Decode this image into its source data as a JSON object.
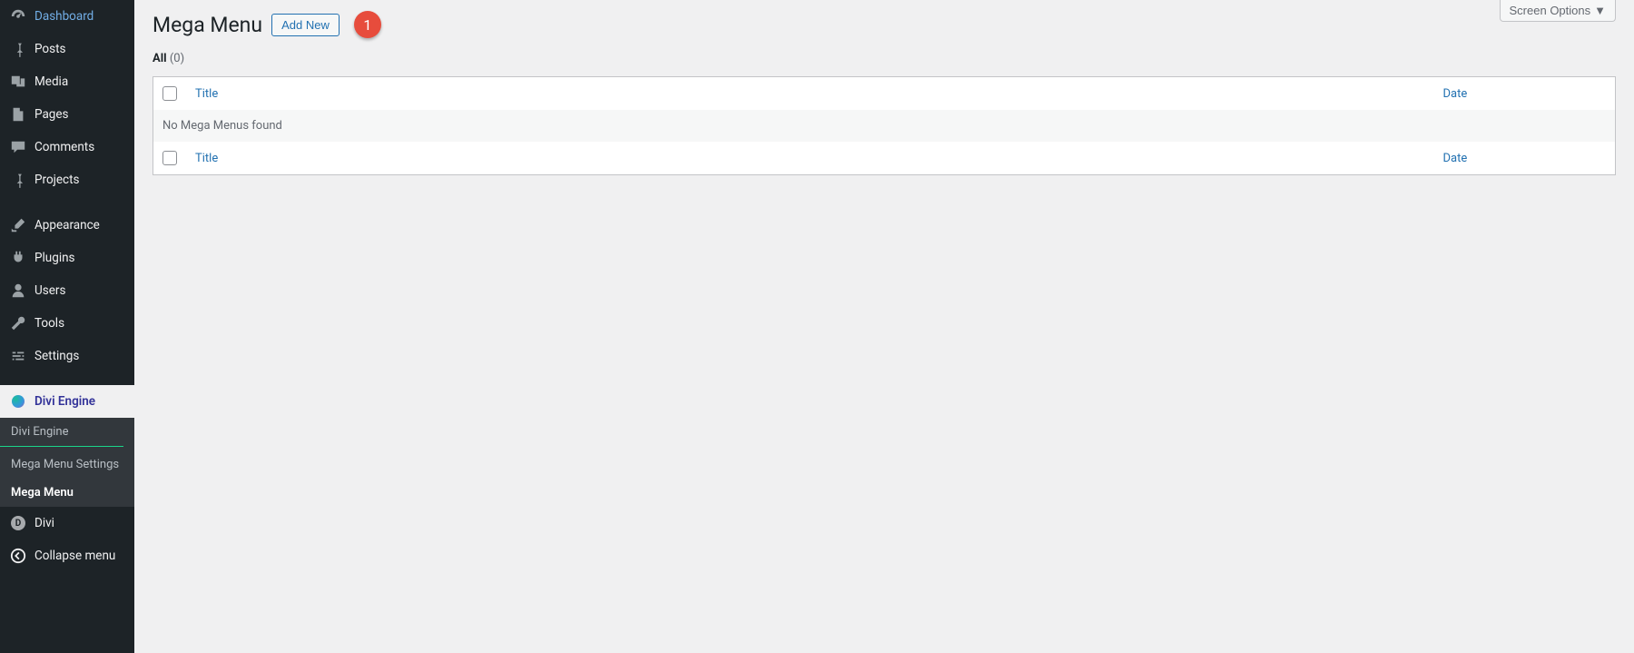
{
  "colors": {
    "accent": "#2271b1",
    "danger_badge": "#e74c3c"
  },
  "top": {
    "screen_options": "Screen Options"
  },
  "sidebar": {
    "items": [
      {
        "id": "dashboard",
        "label": "Dashboard",
        "icon": "gauge-icon"
      },
      {
        "id": "posts",
        "label": "Posts",
        "icon": "pin-icon"
      },
      {
        "id": "media",
        "label": "Media",
        "icon": "media-icon"
      },
      {
        "id": "pages",
        "label": "Pages",
        "icon": "file-icon"
      },
      {
        "id": "comments",
        "label": "Comments",
        "icon": "comment-icon"
      },
      {
        "id": "projects",
        "label": "Projects",
        "icon": "pin-icon"
      },
      {
        "id": "appearance",
        "label": "Appearance",
        "icon": "brush-icon"
      },
      {
        "id": "plugins",
        "label": "Plugins",
        "icon": "plug-icon"
      },
      {
        "id": "users",
        "label": "Users",
        "icon": "user-icon"
      },
      {
        "id": "tools",
        "label": "Tools",
        "icon": "wrench-icon"
      },
      {
        "id": "settings",
        "label": "Settings",
        "icon": "sliders-icon"
      },
      {
        "id": "divi-engine",
        "label": "Divi Engine",
        "icon": "divi-engine-icon",
        "current": true
      },
      {
        "id": "divi",
        "label": "Divi",
        "icon": "divi-d-icon"
      },
      {
        "id": "collapse",
        "label": "Collapse menu",
        "icon": "collapse-icon"
      }
    ],
    "submenu": {
      "parent": "divi-engine",
      "items": [
        {
          "id": "divi-engine-sub",
          "label": "Divi Engine",
          "divider": true
        },
        {
          "id": "mega-menu-settings",
          "label": "Mega Menu Settings"
        },
        {
          "id": "mega-menu",
          "label": "Mega Menu",
          "selected": true
        }
      ]
    }
  },
  "page": {
    "title": "Mega Menu",
    "add_new": "Add New",
    "annotation_number": "1"
  },
  "filter": {
    "label": "All",
    "count_text": "(0)"
  },
  "table": {
    "columns": {
      "title": "Title",
      "date": "Date"
    },
    "empty_message": "No Mega Menus found"
  }
}
